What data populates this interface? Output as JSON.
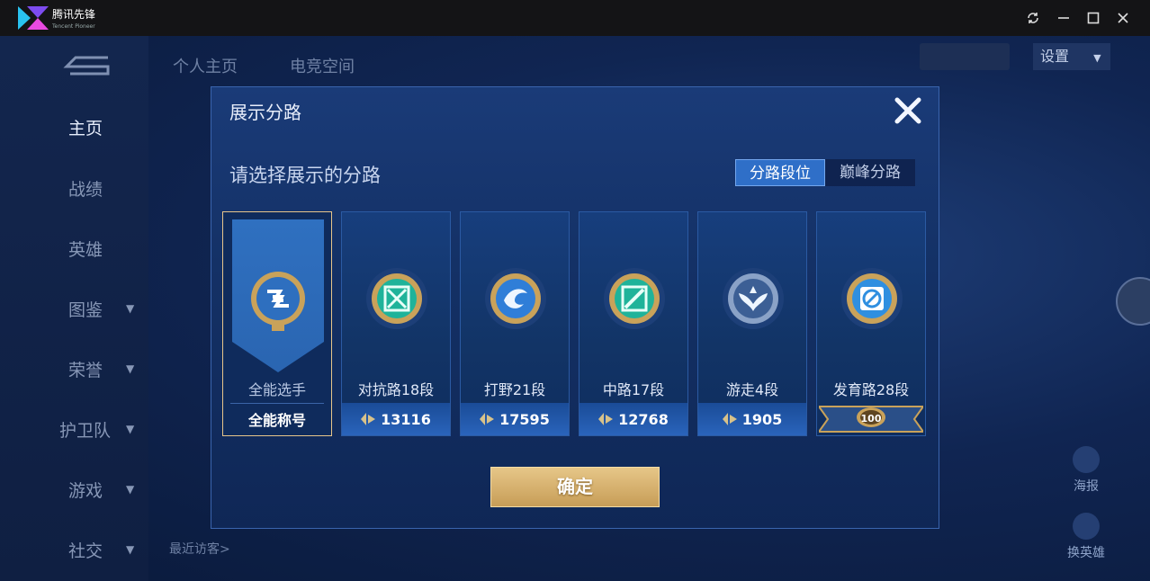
{
  "app": {
    "brand": "腾讯先锋",
    "brand_sub": "Tencent Pioneer"
  },
  "window_controls": [
    "refresh-icon",
    "minimize-icon",
    "maximize-icon",
    "close-icon"
  ],
  "background": {
    "top_tabs": [
      "个人主页",
      "电竞空间"
    ],
    "settings_label": "设置",
    "nav_items": [
      "主页",
      "战绩",
      "英雄",
      "图鉴",
      "荣誉",
      "护卫队",
      "游戏",
      "社交"
    ],
    "recent_visitors": "最近访客>",
    "right_buttons": [
      "海报",
      "换英雄"
    ]
  },
  "modal": {
    "title": "展示分路",
    "subtitle": "请选择展示的分路",
    "segments": [
      {
        "label": "分路段位",
        "active": true
      },
      {
        "label": "巅峰分路",
        "active": false
      }
    ],
    "cards": [
      {
        "name": "全能选手",
        "foot": "全能称号",
        "selected": true,
        "emblem_color": "#2e6fbf"
      },
      {
        "name": "对抗路18段",
        "foot": "13116",
        "selected": false,
        "emblem_color": "#1fb39a"
      },
      {
        "name": "打野21段",
        "foot": "17595",
        "selected": false,
        "emblem_color": "#2f7ed8"
      },
      {
        "name": "中路17段",
        "foot": "12768",
        "selected": false,
        "emblem_color": "#1fb39a"
      },
      {
        "name": "游走4段",
        "foot": "1905",
        "selected": false,
        "emblem_color": "#8aa2c7"
      },
      {
        "name": "发育路28段",
        "foot": "100",
        "selected": false,
        "emblem_color": "#2f8fe0"
      }
    ],
    "confirm_label": "确定"
  },
  "colors": {
    "gold": "#e7c58a",
    "accent_blue": "#2f6fc8"
  }
}
